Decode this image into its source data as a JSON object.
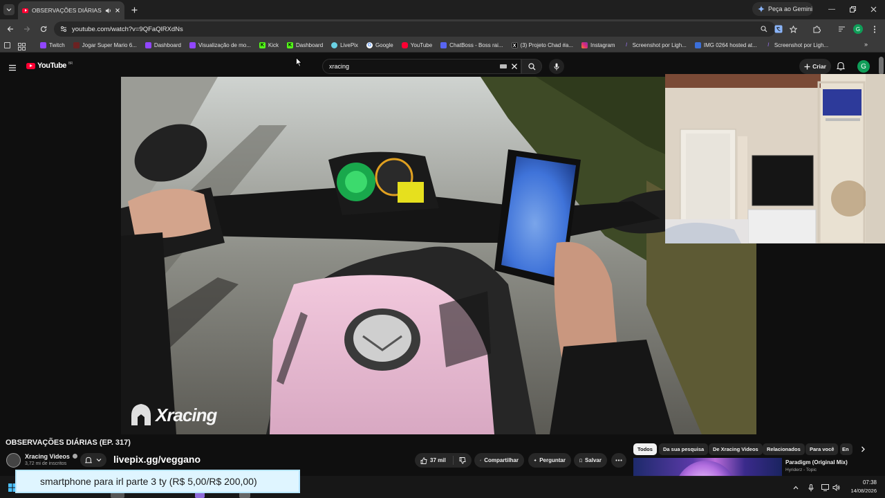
{
  "browser": {
    "tab_title": "OBSERVAÇÕES DIÁRIAS (EP.",
    "new_tab_icon": "plus-icon",
    "gemini_label": "Peça ao Gemini",
    "url": "youtube.com/watch?v=9QFaQlRXdNs",
    "profile_initial": "G"
  },
  "bookmarks": [
    {
      "label": "Twitch",
      "color": "#9146ff"
    },
    {
      "label": "Jogar Super Mario 6...",
      "color": "#a33a3a"
    },
    {
      "label": "Dashboard",
      "color": "#9146ff"
    },
    {
      "label": "Visualização de mo...",
      "color": "#9146ff"
    },
    {
      "label": "Kick",
      "color": "#53fc18"
    },
    {
      "label": "Dashboard",
      "color": "#53fc18"
    },
    {
      "label": "LivePix",
      "color": "#6ad1e3"
    },
    {
      "label": "Google",
      "color": "#4285f4"
    },
    {
      "label": "YouTube",
      "color": "#ff0033"
    },
    {
      "label": "ChatBoss - Boss rai...",
      "color": "#5865f2"
    },
    {
      "label": "(3) Projeto Chad #a...",
      "color": "#000000"
    },
    {
      "label": "Instagram",
      "color": "#e1306c"
    },
    {
      "label": "Screenshot por Ligh...",
      "color": "#8e6bd9"
    },
    {
      "label": "IMG 0264 hosted at...",
      "color": "#3b6fd9"
    },
    {
      "label": "Screenshot por Ligh...",
      "color": "#8e6bd9"
    }
  ],
  "youtube": {
    "logo_text": "YouTube",
    "logo_region": "BR",
    "search_value": "xracing",
    "create_label": "Criar",
    "avatar_initial": "G"
  },
  "video": {
    "watermark": "Xracing",
    "title": "OBSERVAÇÕES DIÁRIAS (EP. 317)",
    "channel_name": "Xracing Videos",
    "subscribers": "3,72 mi de inscritos",
    "likes": "37 mil",
    "share_label": "Compartilhar",
    "ask_label": "Perguntar",
    "save_label": "Salvar"
  },
  "stream_overlay": {
    "livepix_url": "livepix.gg/veggano",
    "donation_text": "smartphone para irl parte 3 ty (R$ 5,00/R$ 200,00)"
  },
  "chips": [
    "Todos",
    "Da sua pesquisa",
    "De Xracing Videos",
    "Relacionados",
    "Para você",
    "En"
  ],
  "recommendation": {
    "title": "Paradigm (Original Mix)",
    "channel": "Hyriderz - Topic"
  },
  "taskbar": {
    "time": "07:38",
    "date": "14/08/2026"
  }
}
